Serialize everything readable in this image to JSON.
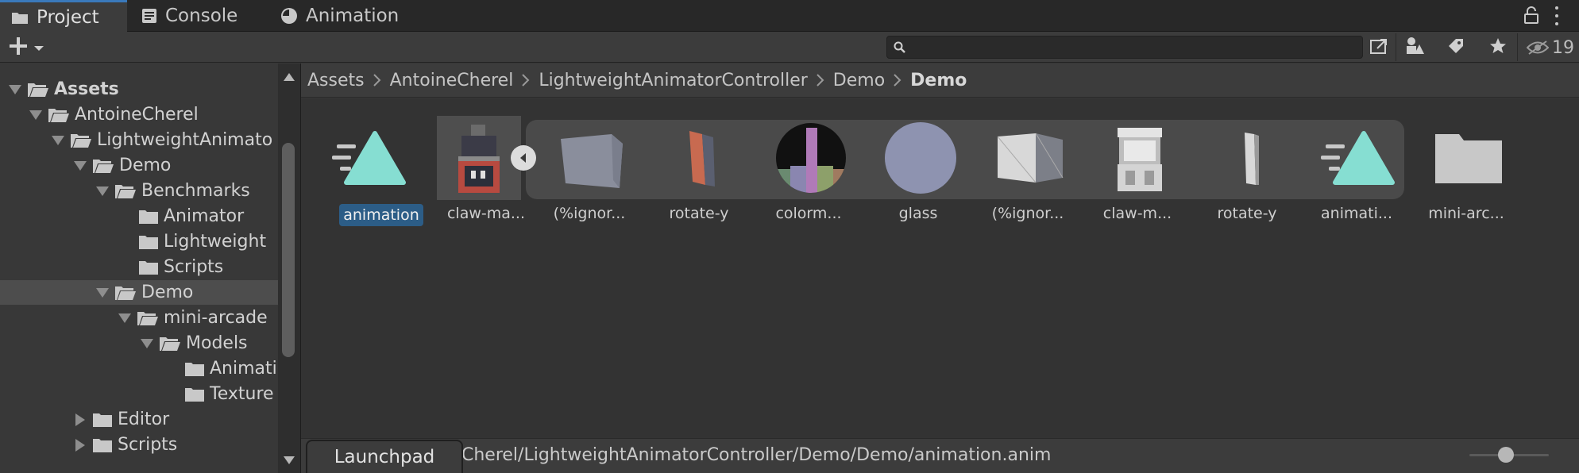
{
  "tabs": [
    {
      "label": "Project",
      "icon": "folder-icon",
      "active": true
    },
    {
      "label": "Console",
      "icon": "console-icon",
      "active": false
    },
    {
      "label": "Animation",
      "icon": "animation-clock-icon",
      "active": false
    }
  ],
  "toolbar": {
    "add_icon": "plus-icon",
    "search": {
      "value": "",
      "placeholder": ""
    },
    "hidden_count": "19"
  },
  "tree": [
    {
      "label": "Assets",
      "bold": true
    },
    {
      "label": "AntoineCherel"
    },
    {
      "label": "LightweightAnimato"
    },
    {
      "label": "Demo"
    },
    {
      "label": "Benchmarks"
    },
    {
      "label": "Animator"
    },
    {
      "label": "Lightweight"
    },
    {
      "label": "Scripts"
    },
    {
      "label": "Demo",
      "selected": true
    },
    {
      "label": "mini-arcade"
    },
    {
      "label": "Models"
    },
    {
      "label": "Animati"
    },
    {
      "label": "Texture"
    },
    {
      "label": "Editor"
    },
    {
      "label": "Scripts"
    }
  ],
  "breadcrumb": [
    "Assets",
    "AntoineCherel",
    "LightweightAnimatorController",
    "Demo",
    "Demo"
  ],
  "assets": [
    {
      "label": "animation",
      "icon": "animation-clip-icon",
      "selected": true
    },
    {
      "label": "claw-ma...",
      "icon": "arcade-machine-prefab-icon"
    },
    {
      "label": "(%ignor...",
      "icon": "cube-mesh-icon"
    },
    {
      "label": "rotate-y",
      "icon": "panel-mesh-icon"
    },
    {
      "label": "colorm...",
      "icon": "colormap-sphere-icon"
    },
    {
      "label": "glass",
      "icon": "glass-material-sphere-icon"
    },
    {
      "label": "(%ignor...",
      "icon": "plane-mesh-icon"
    },
    {
      "label": "claw-m...",
      "icon": "claw-machine-mesh-icon"
    },
    {
      "label": "rotate-y",
      "icon": "thin-panel-mesh-icon"
    },
    {
      "label": "animati...",
      "icon": "animation-clip-icon"
    },
    {
      "label": "mini-arc...",
      "icon": "folder-icon"
    }
  ],
  "status": {
    "path": "Cherel/LightweightAnimatorController/Demo/Demo/animation.anim",
    "launchpad_label": "Launchpad",
    "zoom_fraction": 0.46
  },
  "colors": {
    "accent": "#3a79bb",
    "selection": "#2c5d87",
    "panel": "#383838"
  }
}
